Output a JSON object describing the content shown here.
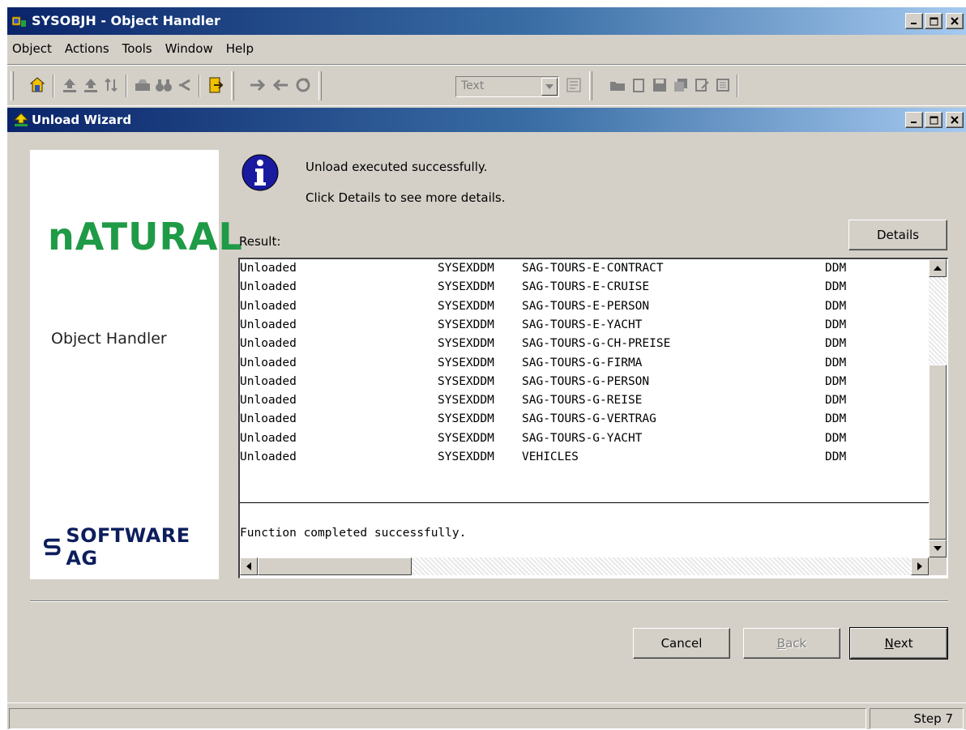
{
  "window": {
    "title": "SYSOBJH - Object Handler"
  },
  "menu": [
    "Object",
    "Actions",
    "Tools",
    "Window",
    "Help"
  ],
  "toolbar": {
    "combo_value": "Text"
  },
  "wizard": {
    "title": "Unload Wizard",
    "brand_name": "nATURAL",
    "brand_product": "Object Handler",
    "vendor": "SOFTWARE AG",
    "message": "Unload executed successfully.",
    "hint": "Click Details to see more details.",
    "result_label": "Result:",
    "details_button": "Details",
    "results": [
      {
        "status": "Unloaded",
        "library": "SYSEXDDM",
        "object": "SAG-TOURS-E-CONTRACT",
        "type": "DDM"
      },
      {
        "status": "Unloaded",
        "library": "SYSEXDDM",
        "object": "SAG-TOURS-E-CRUISE",
        "type": "DDM"
      },
      {
        "status": "Unloaded",
        "library": "SYSEXDDM",
        "object": "SAG-TOURS-E-PERSON",
        "type": "DDM"
      },
      {
        "status": "Unloaded",
        "library": "SYSEXDDM",
        "object": "SAG-TOURS-E-YACHT",
        "type": "DDM"
      },
      {
        "status": "Unloaded",
        "library": "SYSEXDDM",
        "object": "SAG-TOURS-G-CH-PREISE",
        "type": "DDM"
      },
      {
        "status": "Unloaded",
        "library": "SYSEXDDM",
        "object": "SAG-TOURS-G-FIRMA",
        "type": "DDM"
      },
      {
        "status": "Unloaded",
        "library": "SYSEXDDM",
        "object": "SAG-TOURS-G-PERSON",
        "type": "DDM"
      },
      {
        "status": "Unloaded",
        "library": "SYSEXDDM",
        "object": "SAG-TOURS-G-REISE",
        "type": "DDM"
      },
      {
        "status": "Unloaded",
        "library": "SYSEXDDM",
        "object": "SAG-TOURS-G-VERTRAG",
        "type": "DDM"
      },
      {
        "status": "Unloaded",
        "library": "SYSEXDDM",
        "object": "SAG-TOURS-G-YACHT",
        "type": "DDM"
      },
      {
        "status": "Unloaded",
        "library": "SYSEXDDM",
        "object": "VEHICLES",
        "type": "DDM"
      }
    ],
    "result_footer": "Function completed successfully.",
    "cancel_button": "Cancel",
    "back_button": "Back",
    "next_button": "Next"
  },
  "statusbar": {
    "main": "",
    "step": "Step 7"
  },
  "colors": {
    "title_gradient_start": "#0a246a",
    "title_gradient_end": "#a6caf0",
    "face": "#d4d0c8",
    "brand_green": "#1f9a46",
    "brand_navy": "#0c1e5c"
  },
  "icons": {
    "toolbar": [
      "home-icon",
      "unload-icon",
      "load-icon",
      "sort-icon",
      "scan-icon",
      "binoculars-icon",
      "back-arrow-icon",
      "exit-icon",
      "right-arrow-icon",
      "left-arrow-icon",
      "refresh-icon",
      "text-options-icon",
      "open-folder-icon",
      "new-document-icon",
      "save-icon",
      "copy-icon",
      "edit-icon",
      "list-icon"
    ]
  }
}
